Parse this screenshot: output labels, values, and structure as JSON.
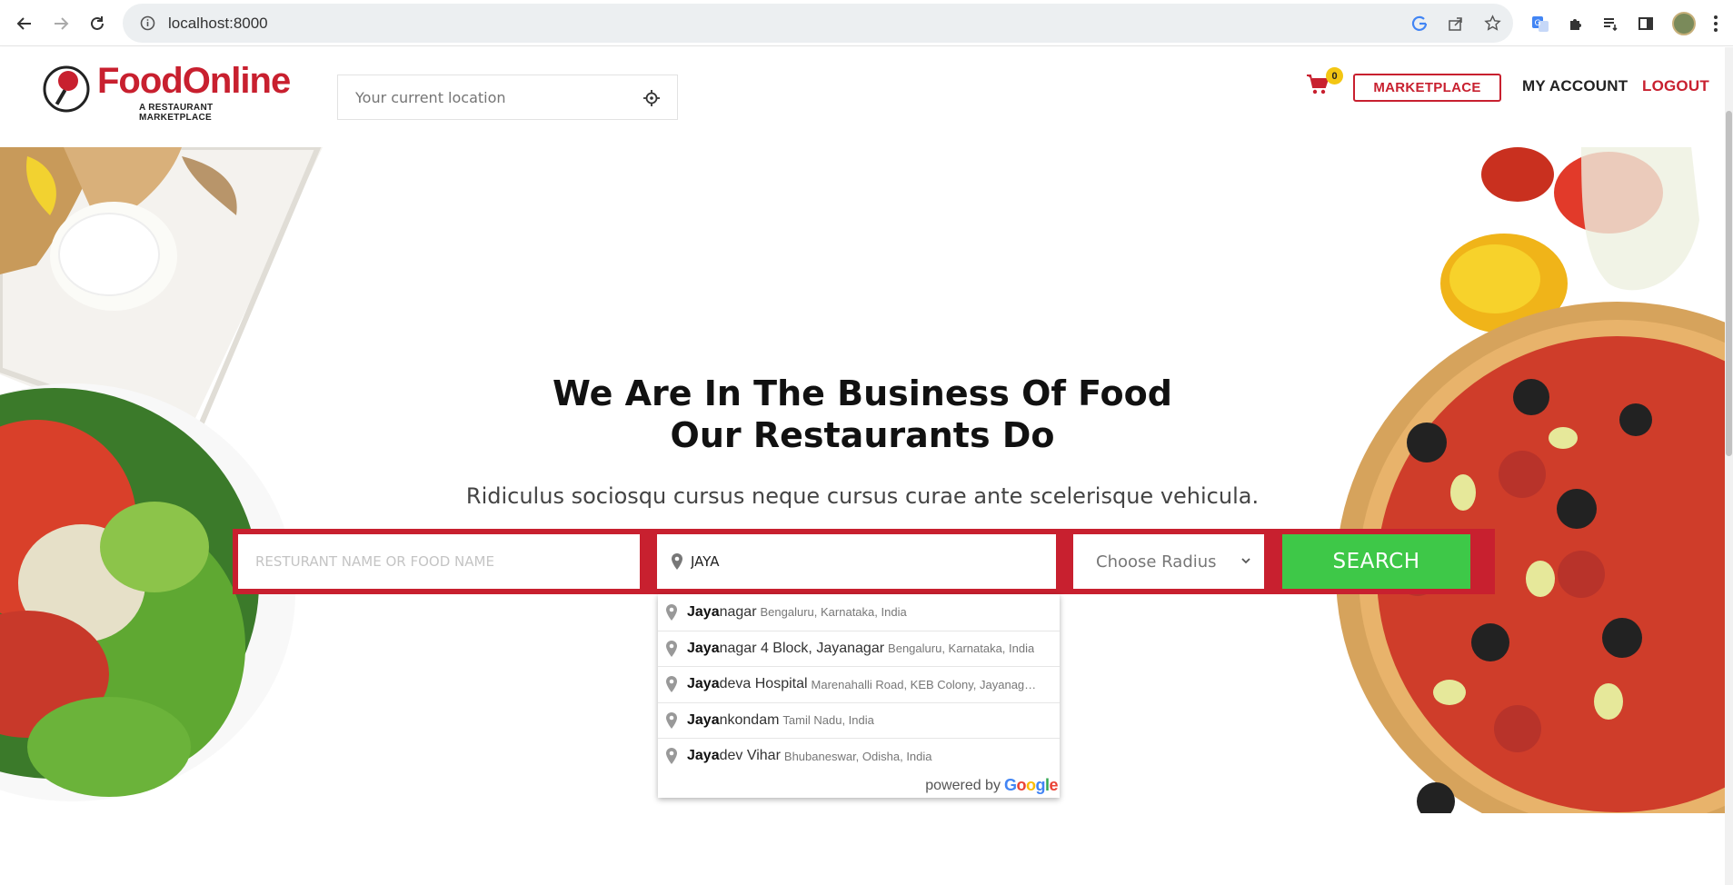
{
  "browser": {
    "url": "localhost:8000"
  },
  "header": {
    "brand": "FoodOnline",
    "tagline": "A RESTAURANT MARKETPLACE",
    "location_placeholder": "Your current location",
    "cart_count": "0",
    "marketplace_label": "MARKETPLACE",
    "account_label": "MY ACCOUNT",
    "logout_label": "LOGOUT"
  },
  "hero": {
    "title_line1": "We Are In The Business Of Food",
    "title_line2": "Our Restaurants Do",
    "subtitle": "Ridiculus sociosqu cursus neque cursus curae ante scelerisque vehicula."
  },
  "search": {
    "keyword_placeholder": "RESTURANT NAME OR FOOD NAME",
    "location_value": "JAYA",
    "radius_label": "Choose Radius",
    "button_label": "SEARCH"
  },
  "autocomplete": {
    "items": [
      {
        "match": "Jaya",
        "rest": "nagar",
        "secondary": "Bengaluru, Karnataka, India"
      },
      {
        "match": "Jaya",
        "rest": "nagar 4 Block, Jayanagar",
        "secondary": "Bengaluru, Karnataka, India"
      },
      {
        "match": "Jaya",
        "rest": "deva Hospital",
        "secondary": "Marenahalli Road, KEB Colony, Jayanag…"
      },
      {
        "match": "Jaya",
        "rest": "nkondam",
        "secondary": "Tamil Nadu, India"
      },
      {
        "match": "Jaya",
        "rest": "dev Vihar",
        "secondary": "Bhubaneswar, Odisha, India"
      }
    ],
    "powered_by": "powered by",
    "google": "Google"
  },
  "colors": {
    "brand_red": "#c8202f",
    "search_green": "#3ec848",
    "badge_yellow": "#f3c613"
  }
}
